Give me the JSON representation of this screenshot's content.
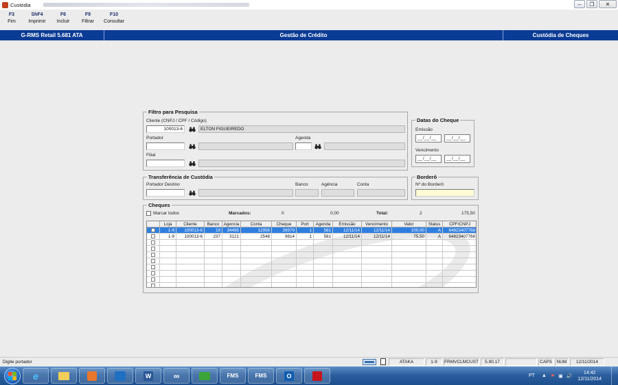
{
  "window": {
    "title": "Custódia"
  },
  "toolbar": [
    {
      "key": "F3",
      "label": "Fim"
    },
    {
      "key": "ShF4",
      "label": "Imprimir"
    },
    {
      "key": "F6",
      "label": "Incluir"
    },
    {
      "key": "F9",
      "label": "Filtrar"
    },
    {
      "key": "F10",
      "label": "Consultar"
    }
  ],
  "header": {
    "system": "G-RMS Retail 5.681 ATA",
    "module": "Gestão de Crédito",
    "screen": "Custódia de Cheques"
  },
  "filtro": {
    "legend": "Filtro para Pesquisa",
    "cliente_label": "Cliente (CNPJ / CPF / Código)",
    "cliente_value": "100013-6",
    "cliente_nome": "ELTON FIGUEIREDO",
    "portador_label": "Portador",
    "portador_value": "",
    "agenda_label": "Agenda",
    "filial_label": "Filial",
    "filial_value": ""
  },
  "datas": {
    "legend": "Datas do Cheque",
    "emissao_label": "Emissão",
    "vencimento_label": "Vencimento",
    "placeholder": "__/__/__"
  },
  "transferencia": {
    "legend": "Transferência de Custódia",
    "portador_destino_label": "Portador Destino",
    "banco_label": "Banco",
    "agencia_label": "Agência",
    "conta_label": "Conta"
  },
  "bordero": {
    "legend": "Borderô",
    "numero_label": "Nº do Borderô",
    "numero_value": ""
  },
  "cheques": {
    "legend": "Cheques",
    "marcar_todos_label": "Marcar todos",
    "marcados_label": "Marcados:",
    "marcados_count": "0",
    "marcados_valor": "0,00",
    "total_label": "Total:",
    "total_count": "2",
    "total_valor": "175,50",
    "columns": [
      "Loja",
      "Cliente",
      "Banco",
      "Agencia",
      "Conta",
      "Cheque",
      "Port",
      "Agenda",
      "Emissão",
      "Vencimento",
      "Valor",
      "Status",
      "CPF/CNPJ"
    ],
    "rows": [
      [
        "1-9",
        "100013-6",
        "19",
        "34495",
        "12956",
        "26979",
        "1",
        "581",
        "12/11/14",
        "12/11/14",
        "100,00",
        "A",
        "64823407768"
      ],
      [
        "1-9",
        "100013-6",
        "237",
        "3121",
        "2548",
        "9814",
        "1",
        "581",
        "12/11/14",
        "12/11/14",
        "75,50",
        "A",
        "64823407768"
      ]
    ]
  },
  "statusbar": {
    "message": "Digite portador",
    "company": "ATAKA",
    "loja": "1-9",
    "form": "FRMVCLMCUST",
    "version": "5.90.17",
    "caps": "CAPS",
    "num": "NUM",
    "date": "12/11/2014"
  },
  "taskbar": {
    "apps": [
      "IE",
      "Explorer",
      "Media",
      "Lync",
      "Word",
      "Chrome",
      "Cash",
      "FMS",
      "FMS",
      "Outlook",
      "Acrobat"
    ],
    "lang": "PT",
    "time": "14:42",
    "date": "12/11/2014"
  }
}
